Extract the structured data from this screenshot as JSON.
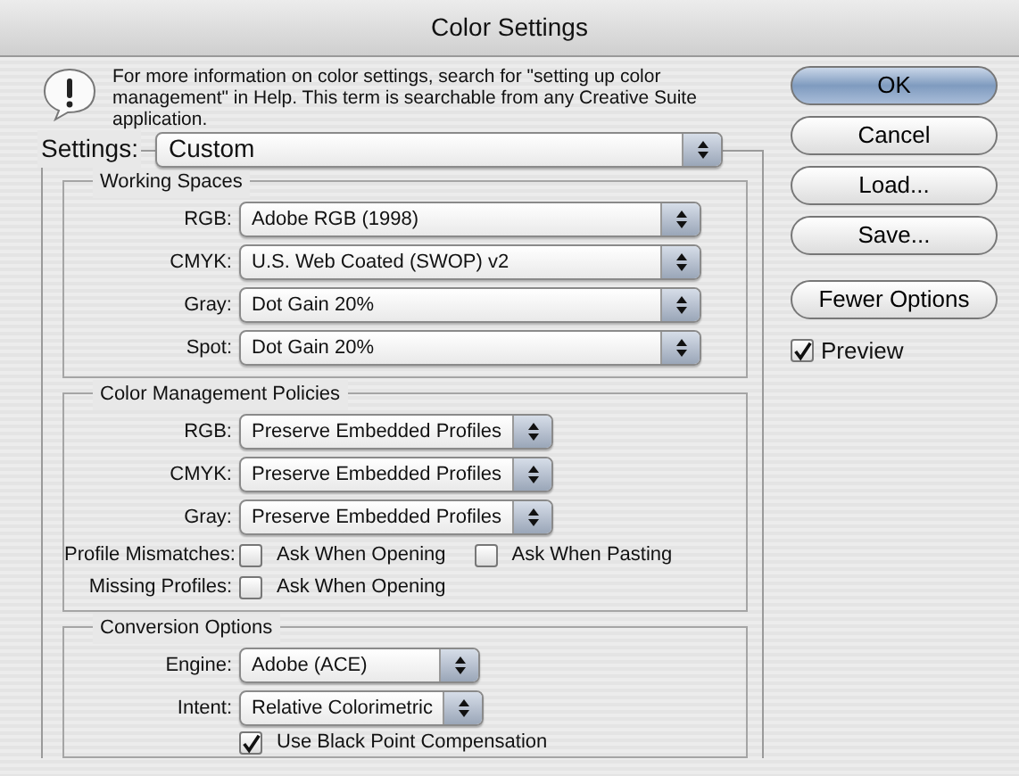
{
  "window": {
    "title": "Color Settings"
  },
  "info": {
    "text": "For more information on color settings, search for \"setting up color management\" in Help. This term is searchable from any Creative Suite application."
  },
  "settings": {
    "label": "Settings:",
    "value": "Custom"
  },
  "working_spaces": {
    "title": "Working Spaces",
    "rows": [
      {
        "label": "RGB:",
        "value": "Adobe RGB (1998)"
      },
      {
        "label": "CMYK:",
        "value": "U.S. Web Coated (SWOP) v2"
      },
      {
        "label": "Gray:",
        "value": "Dot Gain 20%"
      },
      {
        "label": "Spot:",
        "value": "Dot Gain 20%"
      }
    ]
  },
  "policies": {
    "title": "Color Management Policies",
    "rows": [
      {
        "label": "RGB:",
        "value": "Preserve Embedded Profiles"
      },
      {
        "label": "CMYK:",
        "value": "Preserve Embedded Profiles"
      },
      {
        "label": "Gray:",
        "value": "Preserve Embedded Profiles"
      }
    ],
    "options": [
      {
        "label": "Profile Mismatches:",
        "checkboxes": [
          {
            "label": "Ask When Opening",
            "checked": false
          },
          {
            "label": "Ask When Pasting",
            "checked": false
          }
        ]
      },
      {
        "label": "Missing Profiles:",
        "checkboxes": [
          {
            "label": "Ask When Opening",
            "checked": false
          }
        ]
      }
    ]
  },
  "conversion": {
    "title": "Conversion Options",
    "rows": [
      {
        "label": "Engine:",
        "value": "Adobe (ACE)"
      },
      {
        "label": "Intent:",
        "value": "Relative Colorimetric"
      }
    ],
    "checkboxes": [
      {
        "label": "Use Black Point Compensation",
        "checked": true
      }
    ]
  },
  "buttons": [
    {
      "label": "OK",
      "default": true
    },
    {
      "label": "Cancel",
      "default": false
    },
    {
      "label": "Load...",
      "default": false
    },
    {
      "label": "Save...",
      "default": false
    }
  ],
  "options_button": {
    "label": "Fewer Options"
  },
  "preview": {
    "label": "Preview",
    "checked": true
  }
}
